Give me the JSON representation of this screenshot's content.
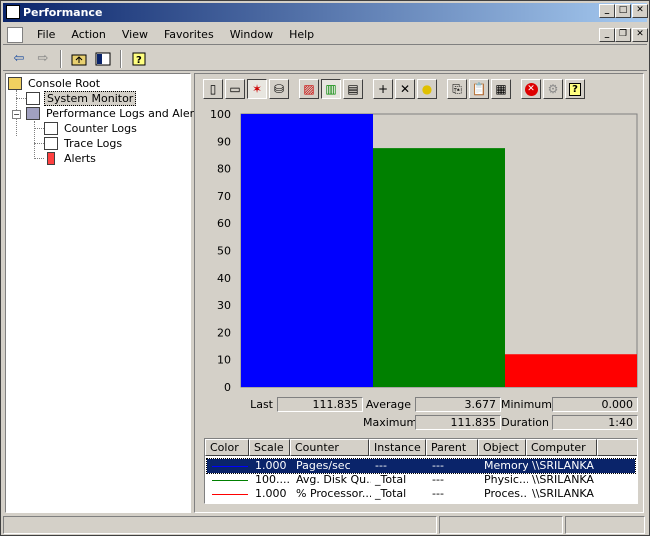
{
  "window": {
    "title": "Performance"
  },
  "menu": [
    {
      "label": "File",
      "name": "file"
    },
    {
      "label": "Action",
      "name": "action"
    },
    {
      "label": "View",
      "name": "view"
    },
    {
      "label": "Favorites",
      "name": "favorites"
    },
    {
      "label": "Window",
      "name": "window"
    },
    {
      "label": "Help",
      "name": "help"
    }
  ],
  "tree": {
    "root": "Console Root",
    "system_monitor": "System Monitor",
    "perf_logs": "Performance Logs and Alerts",
    "counter_logs": "Counter Logs",
    "trace_logs": "Trace Logs",
    "alerts": "Alerts"
  },
  "chart_data": {
    "type": "bar",
    "categories": [
      "Pages/sec",
      "Avg. Disk Qu...",
      "% Processor..."
    ],
    "values": [
      100,
      87.5,
      12
    ],
    "colors": [
      "#0000ff",
      "#008000",
      "#ff0000"
    ],
    "ylim": [
      0,
      100
    ],
    "yticks": [
      "100",
      "90",
      "80",
      "70",
      "60",
      "50",
      "40",
      "30",
      "20",
      "10",
      "0"
    ],
    "grid": false
  },
  "stats": {
    "last_label": "Last",
    "last_value": "111.835",
    "average_label": "Average",
    "average_value": "3.677",
    "minimum_label": "Minimum",
    "minimum_value": "0.000",
    "maximum_label": "Maximum",
    "maximum_value": "111.835",
    "duration_label": "Duration",
    "duration_value": "1:40"
  },
  "legend": {
    "columns": [
      "Color",
      "Scale",
      "Counter",
      "Instance",
      "Parent",
      "Object",
      "Computer"
    ],
    "rows": [
      {
        "color": "#0000ff",
        "scale": "1.000",
        "counter": "Pages/sec",
        "instance": "---",
        "parent": "---",
        "object": "Memory",
        "computer": "\\\\SRILANKA"
      },
      {
        "color": "#008000",
        "scale": "100....",
        "counter": "Avg. Disk Qu...",
        "instance": "_Total",
        "parent": "---",
        "object": "Physic...",
        "computer": "\\\\SRILANKA"
      },
      {
        "color": "#ff0000",
        "scale": "1.000",
        "counter": "% Processor...",
        "instance": "_Total",
        "parent": "---",
        "object": "Proces...",
        "computer": "\\\\SRILANKA"
      }
    ]
  }
}
